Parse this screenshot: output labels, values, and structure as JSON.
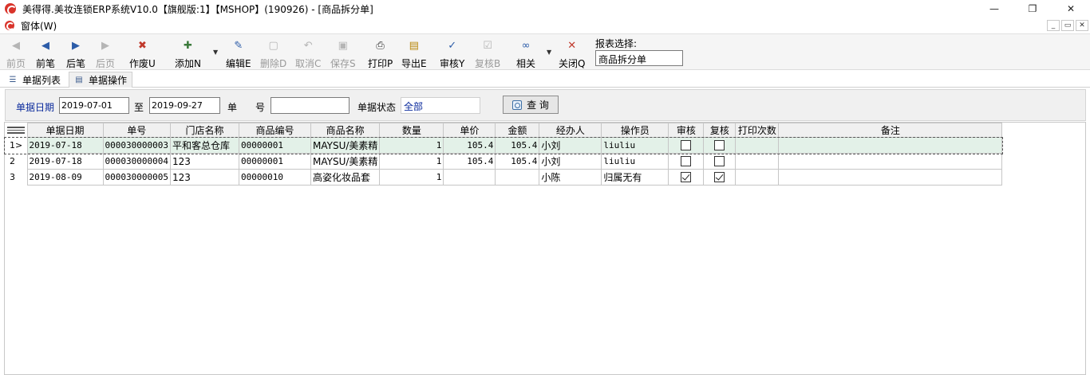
{
  "window": {
    "title": "美得得.美妆连锁ERP系统V10.0【旗舰版:1】【MSHOP】(190926) - [商品拆分单]",
    "minimize_glyph": "—",
    "maximize_glyph": "❐",
    "close_glyph": "✕"
  },
  "menubar": {
    "window_menu": "窗体(W)",
    "mdi_minimize": "_",
    "mdi_restore": "▭",
    "mdi_close": "✕"
  },
  "toolbar": {
    "buttons": [
      {
        "label": "前页",
        "icon": "first-page-icon",
        "glyph": "◀",
        "enabled": false
      },
      {
        "label": "前笔",
        "icon": "prev-record-icon",
        "glyph": "◀",
        "enabled": true
      },
      {
        "label": "后笔",
        "icon": "next-record-icon",
        "glyph": "▶",
        "enabled": true
      },
      {
        "label": "后页",
        "icon": "last-page-icon",
        "glyph": "▶",
        "enabled": false
      },
      {
        "label": "作废U",
        "icon": "void-icon",
        "glyph": "✖",
        "enabled": true
      },
      {
        "label": "添加N",
        "icon": "add-icon",
        "glyph": "✚",
        "enabled": true
      },
      {
        "label": "编辑E",
        "icon": "edit-icon",
        "glyph": "✎",
        "enabled": true
      },
      {
        "label": "删除D",
        "icon": "delete-icon",
        "glyph": "▢",
        "enabled": false
      },
      {
        "label": "取消C",
        "icon": "cancel-icon",
        "glyph": "↶",
        "enabled": false
      },
      {
        "label": "保存S",
        "icon": "save-icon",
        "glyph": "▣",
        "enabled": false
      },
      {
        "label": "打印P",
        "icon": "print-icon",
        "glyph": "⎙",
        "enabled": true
      },
      {
        "label": "导出E",
        "icon": "export-icon",
        "glyph": "▤",
        "enabled": true
      },
      {
        "label": "审核Y",
        "icon": "approve-icon",
        "glyph": "✓",
        "enabled": true
      },
      {
        "label": "复核B",
        "icon": "recheck-icon",
        "glyph": "☑",
        "enabled": false
      },
      {
        "label": "相关",
        "icon": "link-icon",
        "glyph": "∞",
        "enabled": true
      },
      {
        "label": "关闭Q",
        "icon": "close-icon",
        "glyph": "✕",
        "enabled": true
      }
    ],
    "dropdown_glyph": "▼",
    "report_select_label": "报表选择:",
    "report_select_value": "商品拆分单"
  },
  "tabs": [
    {
      "label": "单据列表",
      "icon": "list-icon"
    },
    {
      "label": "单据操作",
      "icon": "form-icon"
    }
  ],
  "query": {
    "date_label": "单据日期",
    "date_from": "2019-07-01",
    "to_label": "至",
    "date_to": "2019-09-27",
    "no_label_1": "单",
    "no_label_2": "号",
    "no_value": "",
    "status_label": "单据状态",
    "status_value": "全部",
    "search_button": "查 询"
  },
  "grid": {
    "columns": [
      "单据日期",
      "单号",
      "门店名称",
      "商品编号",
      "商品名称",
      "数量",
      "单价",
      "金额",
      "经办人",
      "操作员",
      "审核",
      "复核",
      "打印次数",
      "备注"
    ],
    "rows": [
      {
        "indicator": "1>",
        "date": "2019-07-18",
        "no": "000030000003",
        "store": "平和客总仓库",
        "code": "00000001",
        "name": "MAYSU/美素精",
        "qty": "1",
        "price": "105.4",
        "amount": "105.4",
        "handler": "小刘",
        "operator": "liuliu",
        "audit": false,
        "recheck": false,
        "prints": "",
        "remark": "",
        "selected": true
      },
      {
        "indicator": "2",
        "date": "2019-07-18",
        "no": "000030000004",
        "store": "123",
        "code": "00000001",
        "name": "MAYSU/美素精",
        "qty": "1",
        "price": "105.4",
        "amount": "105.4",
        "handler": "小刘",
        "operator": "liuliu",
        "audit": false,
        "recheck": false,
        "prints": "",
        "remark": "",
        "selected": false
      },
      {
        "indicator": "3",
        "date": "2019-08-09",
        "no": "000030000005",
        "store": "123",
        "code": "00000010",
        "name": "高姿化妆品套",
        "qty": "1",
        "price": "",
        "amount": "",
        "handler": "小陈",
        "operator": "归属无有",
        "audit": true,
        "recheck": true,
        "prints": "",
        "remark": "",
        "selected": false
      }
    ]
  }
}
